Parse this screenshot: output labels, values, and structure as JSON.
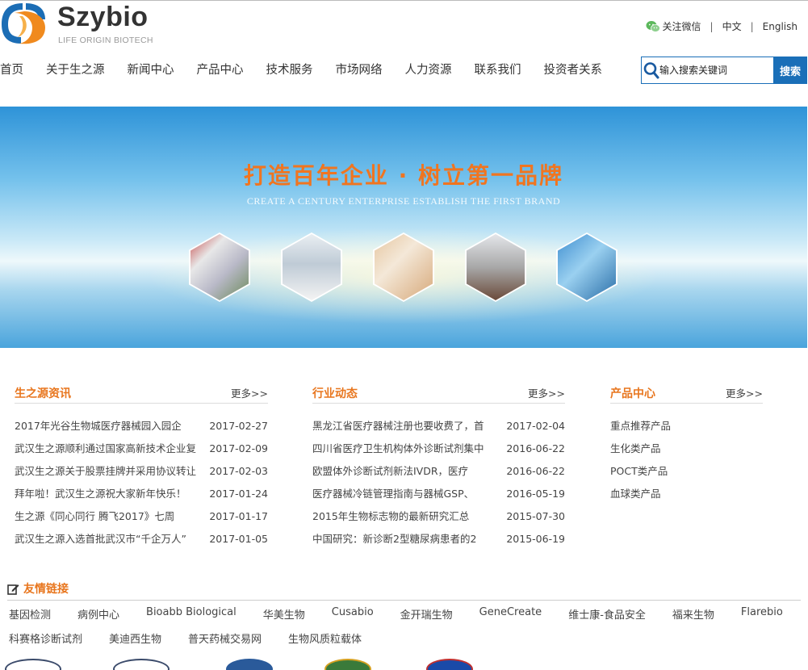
{
  "header": {
    "brand_name": "Szybio",
    "brand_sub": "LIFE ORIGIN BIOTECH",
    "links": {
      "wechat": "关注微信",
      "sep": "|",
      "chinese": "中文",
      "english": "English"
    }
  },
  "nav": {
    "items": [
      {
        "label": "首页"
      },
      {
        "label": "关于生之源"
      },
      {
        "label": "新闻中心"
      },
      {
        "label": "产品中心"
      },
      {
        "label": "技术服务"
      },
      {
        "label": "市场网络"
      },
      {
        "label": "人力资源"
      },
      {
        "label": "联系我们"
      },
      {
        "label": "投资者关系"
      }
    ]
  },
  "search": {
    "placeholder": "输入搜索关键词",
    "button": "搜索"
  },
  "banner": {
    "slogan": "打造百年企业 · 树立第一品牌",
    "slogan_en": "CREATE A CENTURY ENTERPRISE  ESTABLISH THE FIRST BRAND"
  },
  "columns": {
    "news": {
      "title": "生之源资讯",
      "more": "更多>>",
      "items": [
        {
          "title": "2017年光谷生物城医疗器械园入园企",
          "date": "2017-02-27"
        },
        {
          "title": "武汉生之源顺利通过国家高新技术企业复",
          "date": "2017-02-09"
        },
        {
          "title": "武汉生之源关于股票挂牌并采用协议转让",
          "date": "2017-02-03"
        },
        {
          "title": "拜年啦！武汉生之源祝大家新年快乐！",
          "date": "2017-01-24"
        },
        {
          "title": "生之源《同心同行 腾飞2017》七周",
          "date": "2017-01-17"
        },
        {
          "title": "武汉生之源入选首批武汉市“千企万人”",
          "date": "2017-01-05"
        }
      ]
    },
    "industry": {
      "title": "行业动态",
      "more": "更多>>",
      "items": [
        {
          "title": "黑龙江省医疗器械注册也要收费了，首",
          "date": "2017-02-04"
        },
        {
          "title": "四川省医疗卫生机构体外诊断试剂集中",
          "date": "2016-06-22"
        },
        {
          "title": "欧盟体外诊断试剂新法IVDR，医疗",
          "date": "2016-06-22"
        },
        {
          "title": "医疗器械冷链管理指南与器械GSP、",
          "date": "2016-05-19"
        },
        {
          "title": "2015年生物标志物的最新研究汇总",
          "date": "2015-07-30"
        },
        {
          "title": "中国研究：新诊断2型糖尿病患者的2",
          "date": "2015-06-19"
        }
      ]
    },
    "products": {
      "title": "产品中心",
      "more": "更多>>",
      "items": [
        {
          "title": "重点推荐产品"
        },
        {
          "title": "生化类产品"
        },
        {
          "title": "POCT类产品"
        },
        {
          "title": "血球类产品"
        }
      ]
    }
  },
  "friend_links": {
    "title": "友情链接",
    "row1": [
      "基因检测",
      "病例中心",
      "Bioabb Biological",
      "华美生物",
      "Cusabio",
      "金开瑞生物",
      "GeneCreate",
      "维士康-食品安全",
      "福来生物",
      "Flarebio"
    ],
    "row2": [
      "科赛格诊断试剂",
      "美迪西生物",
      "普天药械交易网",
      "生物风质粒载体"
    ]
  },
  "colors": {
    "accent_orange": "#e8761e",
    "brand_blue": "#1a6fb8"
  }
}
